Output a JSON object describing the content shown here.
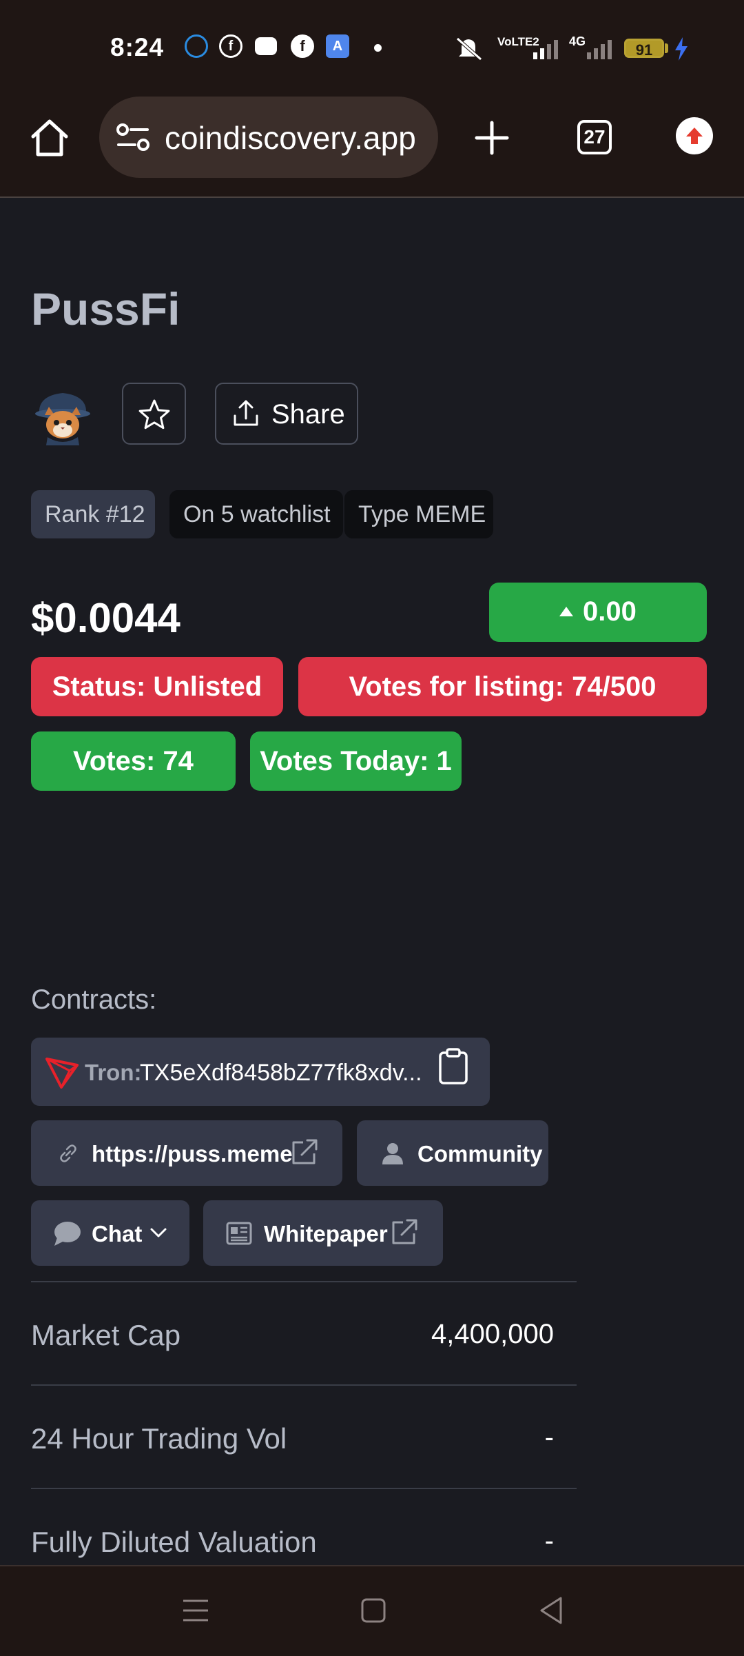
{
  "status_bar": {
    "time": "8:24",
    "notification_icons": [
      "imo-icon",
      "facebook-icon",
      "discord-icon",
      "facebook-icon",
      "translate-icon"
    ],
    "network_label_1": "VoLTE2",
    "network_label_2": "4G",
    "battery": "91"
  },
  "browser": {
    "url": "coindiscovery.app",
    "tab_count": "27"
  },
  "coin": {
    "name": "PussFi",
    "share_label": "Share",
    "rank": "Rank #12",
    "watchlist": "On 5 watchlist",
    "type": "Type MEME",
    "price": "$0.0044",
    "change": "0.00",
    "status": "Status: Unlisted",
    "votes_for_listing": "Votes for listing: 74/500",
    "votes": "Votes: 74",
    "votes_today": "Votes Today: 1"
  },
  "contracts": {
    "label": "Contracts:",
    "chain": "Tron:",
    "address": "TX5eXdf8458bZ77fk8xdv..."
  },
  "links": {
    "website": "https://puss.meme",
    "community": "Community",
    "chat": "Chat",
    "whitepaper": "Whitepaper"
  },
  "stats": [
    {
      "label": "Market Cap",
      "value": "4,400,000"
    },
    {
      "label": "24 Hour Trading Vol",
      "value": "-"
    },
    {
      "label": "Fully Diluted Valuation",
      "value": "-"
    }
  ],
  "colors": {
    "background": "#1a1b21",
    "green": "#27a846",
    "red": "#dc3446",
    "chip": "#353949",
    "tron_red": "#e8212a"
  }
}
